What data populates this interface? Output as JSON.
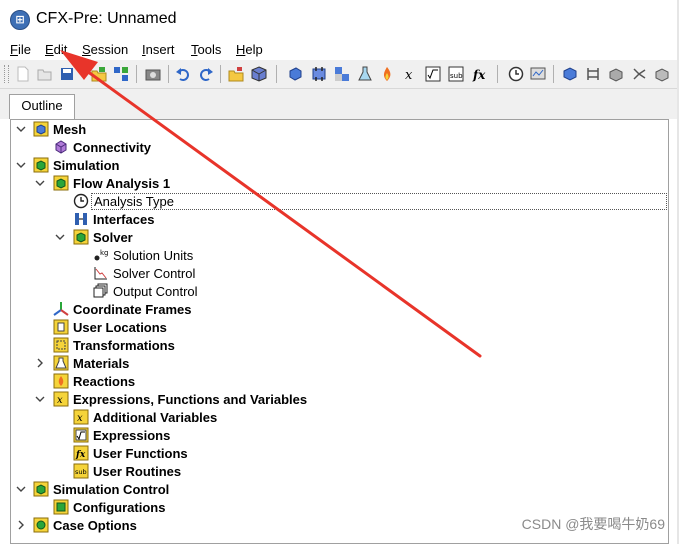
{
  "window": {
    "title": "CFX-Pre:  Unnamed",
    "icon": "cfx-app-icon"
  },
  "menu": {
    "items": [
      {
        "id": "file",
        "label": "File",
        "mnemonic": "F"
      },
      {
        "id": "edit",
        "label": "Edit",
        "mnemonic": "E"
      },
      {
        "id": "session",
        "label": "Session",
        "mnemonic": "S"
      },
      {
        "id": "insert",
        "label": "Insert",
        "mnemonic": "I"
      },
      {
        "id": "tools",
        "label": "Tools",
        "mnemonic": "T"
      },
      {
        "id": "help",
        "label": "Help",
        "mnemonic": "H"
      }
    ]
  },
  "toolbar": {
    "icons": [
      "new-case-icon",
      "open-case-icon",
      "save-case-icon",
      "import-mesh-icon",
      "mesh-operations-icon",
      "camera-icon",
      "undo-icon",
      "redo-icon",
      "open-folder-icon",
      "package-icon",
      "domain-icon",
      "boundary-icon",
      "subdomain-icon",
      "material-flask-icon",
      "reaction-flame-icon",
      "expression-x-icon",
      "expression-sqrt-icon",
      "user-routine-sub-icon",
      "user-function-fx-icon",
      "timer-icon",
      "monitor-icon",
      "solver-control-icon",
      "mesh-adaption-icon",
      "output-control-icon",
      "coordinate-frame-icon",
      "transform-icon"
    ]
  },
  "tabs": [
    {
      "label": "Outline",
      "active": true
    }
  ],
  "tree": {
    "nodes": [
      {
        "name": "mesh",
        "label": "Mesh",
        "bold": true,
        "expanded": true,
        "icon": "mesh-icon"
      },
      {
        "name": "connectivity",
        "label": "Connectivity",
        "bold": true,
        "icon": "connectivity-icon"
      },
      {
        "name": "simulation",
        "label": "Simulation",
        "bold": true,
        "expanded": true,
        "icon": "simulation-icon"
      },
      {
        "name": "flow-analysis-1",
        "label": "Flow Analysis 1",
        "bold": true,
        "expanded": true,
        "icon": "flow-analysis-icon"
      },
      {
        "name": "analysis-type",
        "label": "Analysis Type",
        "bold": false,
        "selected": true,
        "icon": "clock-icon"
      },
      {
        "name": "interfaces",
        "label": "Interfaces",
        "bold": true,
        "icon": "interfaces-icon"
      },
      {
        "name": "solver",
        "label": "Solver",
        "bold": true,
        "expanded": true,
        "icon": "solver-icon"
      },
      {
        "name": "solution-units",
        "label": "Solution Units",
        "bold": false,
        "icon": "units-icon"
      },
      {
        "name": "solver-control",
        "label": "Solver Control",
        "bold": false,
        "icon": "solver-control-icon"
      },
      {
        "name": "output-control",
        "label": "Output Control",
        "bold": false,
        "icon": "output-control-icon"
      },
      {
        "name": "coordinate-frames",
        "label": "Coordinate Frames",
        "bold": true,
        "icon": "coordinate-frames-icon"
      },
      {
        "name": "user-locations",
        "label": "User Locations",
        "bold": true,
        "icon": "user-locations-icon"
      },
      {
        "name": "transformations",
        "label": "Transformations",
        "bold": true,
        "icon": "transformations-icon"
      },
      {
        "name": "materials",
        "label": "Materials",
        "bold": true,
        "expanded": false,
        "icon": "materials-icon"
      },
      {
        "name": "reactions",
        "label": "Reactions",
        "bold": true,
        "icon": "reactions-icon"
      },
      {
        "name": "expressions-functions-variables",
        "label": "Expressions, Functions and Variables",
        "bold": true,
        "expanded": true,
        "icon": "expressions-functions-icon"
      },
      {
        "name": "additional-variables",
        "label": "Additional Variables",
        "bold": true,
        "icon": "additional-variables-icon"
      },
      {
        "name": "expressions",
        "label": "Expressions",
        "bold": true,
        "icon": "expressions-icon"
      },
      {
        "name": "user-functions",
        "label": "User Functions",
        "bold": true,
        "icon": "user-functions-icon"
      },
      {
        "name": "user-routines",
        "label": "User Routines",
        "bold": true,
        "icon": "user-routines-icon"
      },
      {
        "name": "simulation-control",
        "label": "Simulation Control",
        "bold": true,
        "expanded": true,
        "icon": "simulation-control-icon"
      },
      {
        "name": "configurations",
        "label": "Configurations",
        "bold": true,
        "icon": "configurations-icon"
      },
      {
        "name": "case-options",
        "label": "Case Options",
        "bold": true,
        "expanded": false,
        "icon": "case-options-icon"
      }
    ]
  },
  "annotation": {
    "arrow_color": "#e8342a"
  },
  "watermark": {
    "text": "CSDN @我要喝牛奶69"
  },
  "colors": {
    "icon_yellow": "#f5d43a",
    "icon_blue": "#2f67c8",
    "icon_green": "#2aa63a",
    "accent_red": "#e8342a"
  }
}
